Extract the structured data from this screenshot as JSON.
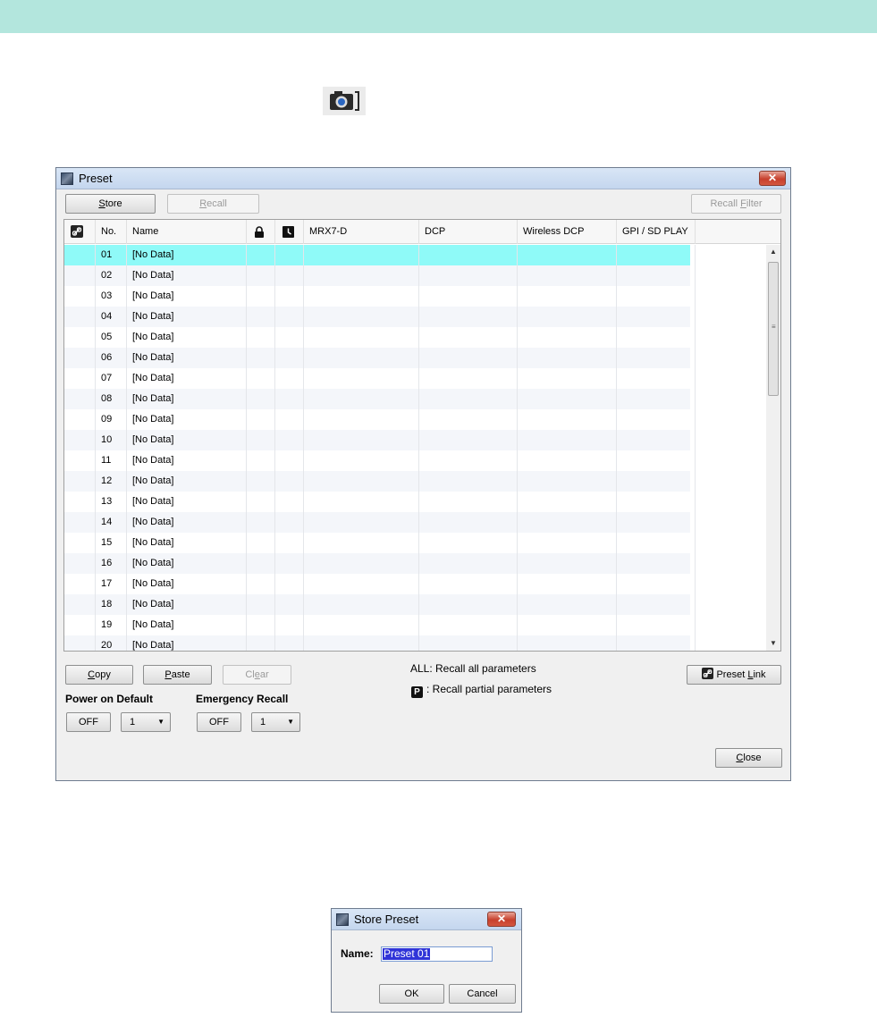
{
  "colors": {
    "band": "#b3e6dd",
    "selected_row": "#8ffaf8",
    "alt_row": "#f4f6fa"
  },
  "top_icon": "camera-icon",
  "preset_window": {
    "title": "Preset",
    "toolbar": {
      "store": {
        "pre": "",
        "key": "S",
        "post": "tore"
      },
      "recall": {
        "pre": "",
        "key": "R",
        "post": "ecall"
      },
      "recall_filter": {
        "pre": "Recall ",
        "key": "F",
        "post": "ilter"
      }
    },
    "columns": [
      {
        "id": "link",
        "icon": "link-icon"
      },
      {
        "id": "no",
        "label": "No."
      },
      {
        "id": "name",
        "label": "Name"
      },
      {
        "id": "lock",
        "icon": "lock-icon"
      },
      {
        "id": "clock",
        "icon": "clock-icon"
      },
      {
        "id": "mrx",
        "label": "MRX7-D"
      },
      {
        "id": "dcp",
        "label": "DCP"
      },
      {
        "id": "wdcp",
        "label": "Wireless DCP"
      },
      {
        "id": "gpi",
        "label": "GPI / SD PLAY"
      }
    ],
    "rows": [
      {
        "no": "01",
        "name": "[No Data]"
      },
      {
        "no": "02",
        "name": "[No Data]"
      },
      {
        "no": "03",
        "name": "[No Data]"
      },
      {
        "no": "04",
        "name": "[No Data]"
      },
      {
        "no": "05",
        "name": "[No Data]"
      },
      {
        "no": "06",
        "name": "[No Data]"
      },
      {
        "no": "07",
        "name": "[No Data]"
      },
      {
        "no": "08",
        "name": "[No Data]"
      },
      {
        "no": "09",
        "name": "[No Data]"
      },
      {
        "no": "10",
        "name": "[No Data]"
      },
      {
        "no": "11",
        "name": "[No Data]"
      },
      {
        "no": "12",
        "name": "[No Data]"
      },
      {
        "no": "13",
        "name": "[No Data]"
      },
      {
        "no": "14",
        "name": "[No Data]"
      },
      {
        "no": "15",
        "name": "[No Data]"
      },
      {
        "no": "16",
        "name": "[No Data]"
      },
      {
        "no": "17",
        "name": "[No Data]"
      },
      {
        "no": "18",
        "name": "[No Data]"
      },
      {
        "no": "19",
        "name": "[No Data]"
      },
      {
        "no": "20",
        "name": "[No Data]"
      }
    ],
    "selected_row": "01",
    "bottom": {
      "copy": {
        "pre": "",
        "key": "C",
        "post": "opy"
      },
      "paste": {
        "pre": "",
        "key": "P",
        "post": "aste"
      },
      "clear": {
        "pre": "Cl",
        "key": "e",
        "post": "ar"
      },
      "legend_all": "ALL: Recall all parameters",
      "legend_p_badge": "P",
      "legend_p": ": Recall partial parameters",
      "preset_link": {
        "pre": "Preset ",
        "key": "L",
        "post": "ink"
      },
      "power_on_default_label": "Power on Default",
      "emergency_recall_label": "Emergency Recall",
      "power_toggle": "OFF",
      "power_select": "1",
      "emergency_toggle": "OFF",
      "emergency_select": "1",
      "close": {
        "pre": "",
        "key": "C",
        "post": "lose"
      }
    }
  },
  "store_dialog": {
    "title": "Store Preset",
    "name_label": "Name:",
    "name_value": "Preset 01",
    "ok": "OK",
    "cancel": "Cancel"
  }
}
